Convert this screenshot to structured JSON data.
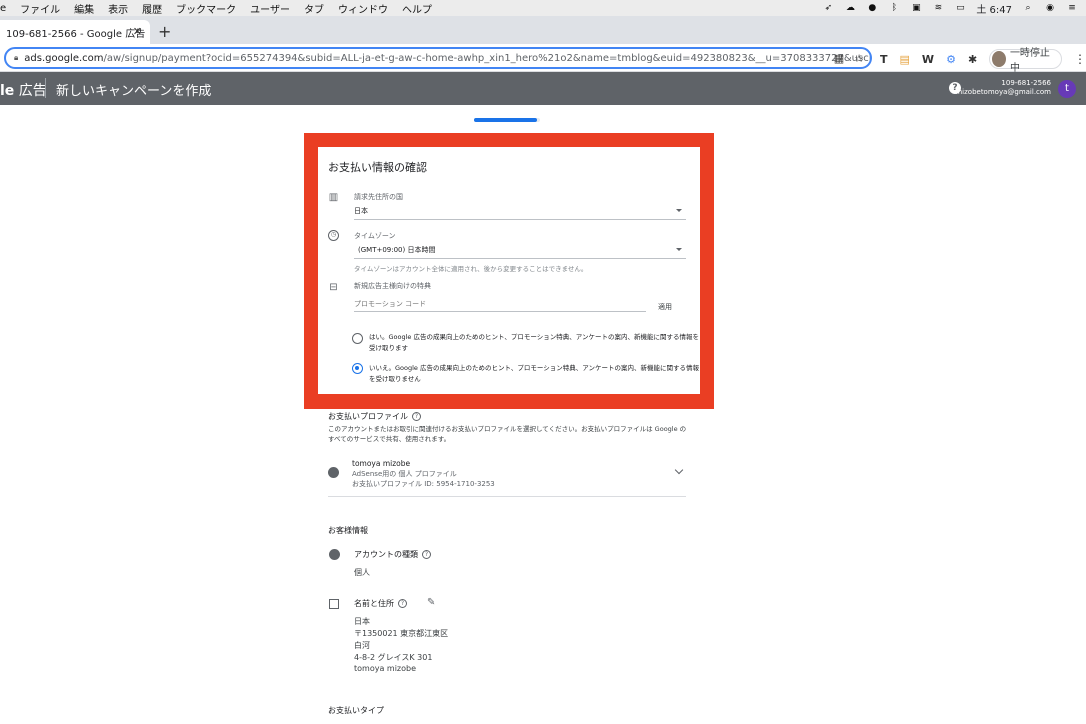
{
  "menubar": {
    "items": [
      "e",
      "ファイル",
      "編集",
      "表示",
      "履歴",
      "ブックマーク",
      "ユーザー",
      "タブ",
      "ウィンドウ",
      "ヘルプ"
    ],
    "clock": "土 6:47"
  },
  "browser": {
    "tab_title": "109-681-2566 - Google 広告",
    "url_host": "ads.google.com",
    "url_path": "/aw/signup/payment?ocid=655274394&subid=ALL-ja-et-g-aw-c-home-awhp_xin1_hero%21o2&name=tmblog&euid=492380823&__u=3708333727&uscid=...",
    "profile_status": "一時停止中",
    "ext_w": "W",
    "ext_t": "T"
  },
  "header": {
    "brand_suffix": "le",
    "brand_ads": "広告",
    "title": "新しいキャンペーンを作成",
    "customer_id": "109-681-2566",
    "email": "mizobetomoya@gmail.com",
    "avatar_letter": "t"
  },
  "progress": {
    "value": 0.95
  },
  "payment_confirm": {
    "title": "お支払い情報の確認",
    "country_label": "請求先住所の国",
    "country_value": "日本",
    "timezone_label": "タイムゾーン",
    "timezone_value": "(GMT+09:00) 日本時間",
    "timezone_hint": "タイムゾーンはアカウント全体に適用され、後から変更することはできません。",
    "promo_label": "新規広告主様向けの特典",
    "promo_placeholder": "プロモーション コード",
    "apply_label": "適用",
    "opt_yes": "はい。Google 広告の成果向上のためのヒント、プロモーション特典、アンケートの案内、新機能に関する情報を受け取ります",
    "opt_no": "いいえ。Google 広告の成果向上のためのヒント、プロモーション特典、アンケートの案内、新機能に関する情報を受け取りません",
    "selected": "no"
  },
  "payment_profile": {
    "title": "お支払いプロファイル",
    "desc": "このアカウントまたはお取引に関連付けるお支払いプロファイルを選択してください。お支払いプロファイルは Google のすべてのサービスで共有、使用されます。",
    "name": "tomoya mizobe",
    "type": "AdSense用の 個人 プロファイル",
    "id_line": "お支払いプロファイル ID: 5954-1710-3253"
  },
  "customer_info": {
    "title": "お客様情報",
    "account_type_label": "アカウントの種類",
    "account_type_value": "個人",
    "name_address_label": "名前と住所",
    "address_lines": [
      "日本",
      "〒1350021 東京都江東区",
      "白河",
      "4-8-2 グレイスK 301",
      "tomoya mizobe"
    ]
  },
  "payment_type": {
    "title": "お支払いタイプ"
  }
}
